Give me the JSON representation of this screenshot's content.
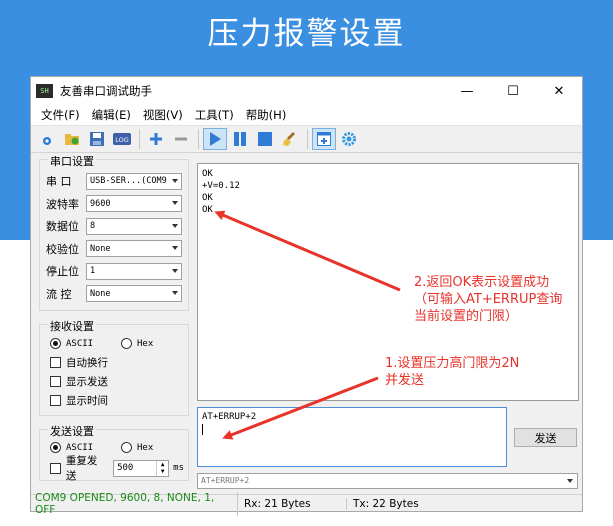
{
  "banner": {
    "title": "压力报警设置"
  },
  "window": {
    "title": "友善串口调试助手",
    "app_icon_text": "SH",
    "controls": {
      "minimize": "—",
      "maximize": "☐",
      "close": "✕"
    }
  },
  "menu": [
    {
      "label": "文件(F)"
    },
    {
      "label": "编辑(E)"
    },
    {
      "label": "视图(V)"
    },
    {
      "label": "工具(T)"
    },
    {
      "label": "帮助(H)"
    }
  ],
  "toolbar": {
    "log_label": "LOG",
    "icons": [
      "new-icon",
      "open-icon",
      "save-icon",
      "log-icon",
      "add-icon",
      "remove-icon",
      "play-icon",
      "pause-icon",
      "stop-icon",
      "clear-icon",
      "window-icon",
      "gear-icon"
    ]
  },
  "serial_settings": {
    "title": "串口设置",
    "fields": [
      {
        "label": "串 口",
        "value": "USB-SER...(COM9"
      },
      {
        "label": "波特率",
        "value": "9600"
      },
      {
        "label": "数据位",
        "value": "8"
      },
      {
        "label": "校验位",
        "value": "None"
      },
      {
        "label": "停止位",
        "value": "1"
      },
      {
        "label": "流 控",
        "value": "None"
      }
    ]
  },
  "receive_settings": {
    "title": "接收设置",
    "ascii": "ASCII",
    "hex": "Hex",
    "selected": "ASCII",
    "options": [
      {
        "label": "自动换行",
        "checked": false
      },
      {
        "label": "显示发送",
        "checked": false
      },
      {
        "label": "显示时间",
        "checked": false
      }
    ]
  },
  "send_settings": {
    "title": "发送设置",
    "ascii": "ASCII",
    "hex": "Hex",
    "selected": "ASCII",
    "repeat_label": "重复发送",
    "repeat_checked": false,
    "interval": "500",
    "unit": "ms"
  },
  "receive_area": {
    "lines": [
      "OK",
      "+V=0.12",
      "OK",
      "OK"
    ]
  },
  "send_area": {
    "text": "AT+ERRUP+2",
    "send_button": "发送",
    "history_value": "AT+ERRUP+2"
  },
  "status": {
    "port": "COM9 OPENED, 9600, 8, NONE, 1, OFF",
    "rx": "Rx: 21 Bytes",
    "tx": "Tx: 22 Bytes",
    "port_color": "#1a8a1a"
  },
  "annotations": {
    "step2_line1": "2.返回OK表示设置成功",
    "step2_line2": "（可输入AT+ERRUP查询",
    "step2_line3": "当前设置的门限）",
    "step1_line1": "1.设置压力高门限为2N",
    "step1_line2": "并发送",
    "color": "#e8322a"
  },
  "colors": {
    "banner": "#3b8fe0",
    "accent": "#2f7bd6"
  }
}
